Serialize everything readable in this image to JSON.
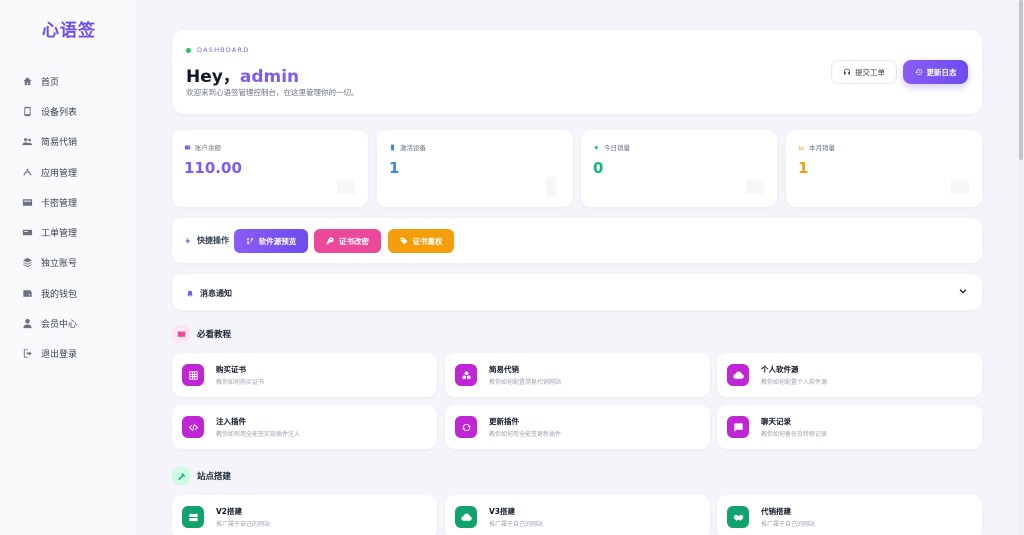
{
  "brand": "心语签",
  "nav": [
    {
      "label": "首页",
      "icon": "home-icon"
    },
    {
      "label": "设备列表",
      "icon": "device-icon"
    },
    {
      "label": "简易代销",
      "icon": "users-icon"
    },
    {
      "label": "应用管理",
      "icon": "apps-icon"
    },
    {
      "label": "卡密管理",
      "icon": "card-icon"
    },
    {
      "label": "工单管理",
      "icon": "ticket-icon"
    },
    {
      "label": "独立账号",
      "icon": "layers-icon"
    },
    {
      "label": "我的钱包",
      "icon": "wallet-icon"
    },
    {
      "label": "会员中心",
      "icon": "user-icon"
    },
    {
      "label": "退出登录",
      "icon": "logout-icon"
    }
  ],
  "header": {
    "label": "DASHBOARD",
    "greeting": "Hey，",
    "username": "admin",
    "welcome": "欢迎来到心语签管理控制台，在这里管理你的一切。",
    "ticket_btn": "提交工单",
    "log_btn": "更新日志"
  },
  "stats": [
    {
      "label": "账户余额",
      "value": "110.00",
      "color": "#7c5cf5"
    },
    {
      "label": "激活设备",
      "value": "1",
      "color": "#3b82f6"
    },
    {
      "label": "今日销量",
      "value": "0",
      "color": "#10b981"
    },
    {
      "label": "本月销量",
      "value": "1",
      "color": "#f59e0b"
    }
  ],
  "quick": {
    "title": "快捷操作",
    "buttons": [
      {
        "label": "软件源预览",
        "color": "#7c5cf5"
      },
      {
        "label": "证书改密",
        "color": "#ec4899"
      },
      {
        "label": "证书重权",
        "color": "#f59e0b"
      }
    ]
  },
  "notice": {
    "title": "消息通知"
  },
  "tutorials": {
    "title": "必看教程",
    "items": [
      {
        "title": "购买证书",
        "sub": "教你如何购买证书",
        "icon": "grid-icon"
      },
      {
        "title": "简易代销",
        "sub": "教你如何配置简易代销网站",
        "icon": "cubes-icon"
      },
      {
        "title": "个人软件源",
        "sub": "教你如何配置个人软件源",
        "icon": "cloud-icon"
      },
      {
        "title": "注入插件",
        "sub": "教你如何用全能签实现插件注入",
        "icon": "code-icon"
      },
      {
        "title": "更新插件",
        "sub": "教你如何用全能签更新插件",
        "icon": "refresh-icon"
      },
      {
        "title": "聊天记录",
        "sub": "教你如何备份及转移记录",
        "icon": "chat-icon"
      }
    ]
  },
  "sites": {
    "title": "站点搭建",
    "items": [
      {
        "title": "V2搭建",
        "sub": "推广属于自己的网站",
        "icon": "server-icon"
      },
      {
        "title": "V3搭建",
        "sub": "推广属于自己的网站",
        "icon": "cloud-icon"
      },
      {
        "title": "代销搭建",
        "sub": "推广属于自己的网站",
        "icon": "handshake-icon"
      }
    ]
  }
}
